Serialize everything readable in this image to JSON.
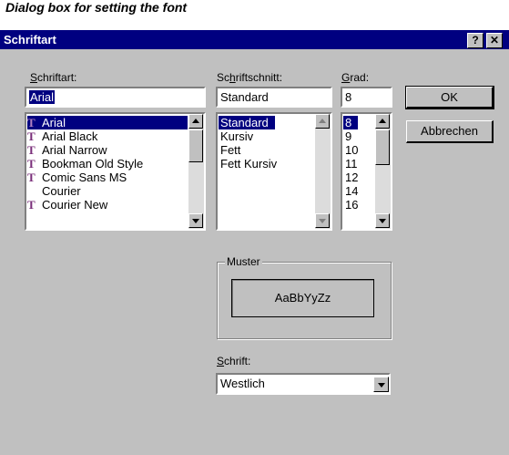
{
  "caption": "Dialog box for setting the font",
  "window": {
    "title": "Schriftart",
    "help_label": "?",
    "close_label": "✕"
  },
  "font": {
    "label_u": "S",
    "label_rest": "chriftart:",
    "value": "Arial",
    "items": [
      {
        "label": "Arial",
        "icon": "truetype-icon",
        "selected": true
      },
      {
        "label": "Arial Black",
        "icon": "truetype-icon"
      },
      {
        "label": "Arial Narrow",
        "icon": "truetype-icon"
      },
      {
        "label": "Bookman Old Style",
        "icon": "truetype-icon"
      },
      {
        "label": "Comic Sans MS",
        "icon": "truetype-icon"
      },
      {
        "label": "Courier",
        "icon": ""
      },
      {
        "label": "Courier New",
        "icon": "truetype-icon"
      }
    ]
  },
  "style": {
    "label_pre": "Sc",
    "label_u": "h",
    "label_rest": "riftschnitt:",
    "value": "Standard",
    "items": [
      "Standard",
      "Kursiv",
      "Fett",
      "Fett Kursiv"
    ]
  },
  "size": {
    "label_u": "G",
    "label_rest": "rad:",
    "value": "8",
    "items": [
      "8",
      "9",
      "10",
      "11",
      "12",
      "14",
      "16"
    ]
  },
  "buttons": {
    "ok": "OK",
    "cancel": "Abbrechen"
  },
  "sample": {
    "label": "Muster",
    "text": "AaBbYyZz"
  },
  "script": {
    "label_u": "S",
    "label_rest": "chrift:",
    "value": "Westlich"
  },
  "colors": {
    "titlebar": "#000080",
    "dialog": "#c0c0c0",
    "selection": "#000080",
    "truetype_icon": "#7a2f7a"
  }
}
